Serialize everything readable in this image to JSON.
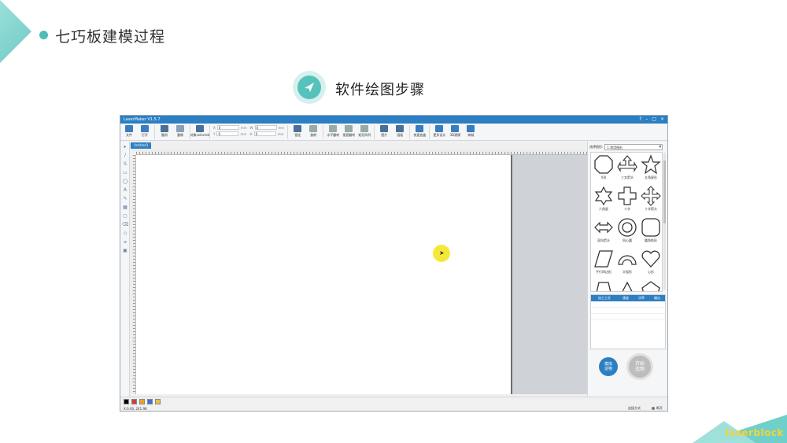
{
  "slide": {
    "title": "七巧板建模过程",
    "step_title": "软件绘图步骤",
    "brand": "laserblock"
  },
  "app": {
    "window_title": "LaserMaker V1.5.7",
    "win_controls": [
      "?",
      "–",
      "□",
      "×"
    ],
    "toolbar": [
      {
        "label": "文件",
        "icon": "folder-icon",
        "color": "#3a7cc0"
      },
      {
        "label": "打开",
        "icon": "file-icon",
        "color": "#3a7cc0"
      },
      {
        "label": "撤消",
        "icon": "undo-icon",
        "color": "#4a6f99"
      },
      {
        "label": "重做",
        "icon": "redo-icon",
        "color": "#8aa0b8"
      },
      {
        "label": "对象selected",
        "icon": "select-icon",
        "color": "#4a6f99"
      }
    ],
    "toolbar_fields": [
      {
        "label": "X",
        "value": "0",
        "unit": "mm"
      },
      {
        "label": "Y",
        "value": "0",
        "unit": "mm"
      },
      {
        "label": "W",
        "value": "0",
        "unit": "mm"
      },
      {
        "label": "H",
        "value": "0",
        "unit": "mm"
      }
    ],
    "toolbar_right": [
      {
        "label": "锁定",
        "icon": "lock-icon",
        "color": "#4a6f99"
      },
      {
        "label": "旋转",
        "icon": "rotate-icon",
        "color": "#9aa"
      },
      {
        "label": "水平翻转",
        "icon": "flip-h-icon",
        "color": "#9aa"
      },
      {
        "label": "垂直翻转",
        "icon": "flip-v-icon",
        "color": "#9aa"
      },
      {
        "label": "矩形阵列",
        "icon": "array-icon",
        "color": "#9aa"
      },
      {
        "label": "图片",
        "icon": "image-icon",
        "color": "#4a6f99"
      },
      {
        "label": "画板",
        "icon": "board-icon",
        "color": "#4a6f99"
      },
      {
        "label": "快速造盒",
        "icon": "box-icon",
        "color": "#3a7cc0"
      },
      {
        "label": "更多设计",
        "icon": "design-icon",
        "color": "#3a7cc0"
      },
      {
        "label": "3D建模",
        "icon": "3d-icon",
        "color": "#3a7cc0"
      },
      {
        "label": "商城",
        "icon": "cart-icon",
        "color": "#3a7cc0"
      }
    ],
    "tab": "Untitled1",
    "left_tools": [
      "▸",
      "/",
      "S",
      "▭",
      "◯",
      "A",
      "✎",
      "▦",
      "▢",
      "⌫",
      "◇",
      "⌀",
      "▣"
    ],
    "right_panel": {
      "select_label": "选择图形:",
      "select_value": "1.常用图形",
      "shapes": [
        {
          "label": "X形",
          "icon": "octagon-shape-icon"
        },
        {
          "label": "三叉箭头",
          "icon": "three-arrow-icon"
        },
        {
          "label": "五角星形",
          "icon": "star5-icon"
        },
        {
          "label": "六角星",
          "icon": "star6-icon"
        },
        {
          "label": "十字",
          "icon": "cross-icon"
        },
        {
          "label": "十字箭头",
          "icon": "cross-arrow-icon"
        },
        {
          "label": "双向箭头",
          "icon": "double-arrow-icon"
        },
        {
          "label": "同心圆",
          "icon": "concentric-icon"
        },
        {
          "label": "圆角矩形",
          "icon": "round-rect-icon"
        },
        {
          "label": "平行四边形",
          "icon": "parallelogram-icon"
        },
        {
          "label": "半弧形",
          "icon": "arc-icon"
        },
        {
          "label": "心形",
          "icon": "heart-icon"
        },
        {
          "label": "",
          "icon": "trapezoid-icon"
        },
        {
          "label": "",
          "icon": "triangle-icon"
        },
        {
          "label": "",
          "icon": "pentagon-icon"
        }
      ],
      "table_headers": [
        "加工工艺",
        "速度",
        "功率",
        "输出"
      ],
      "btn_sim": "模拟\n造物",
      "btn_start": "开始\n造物"
    },
    "status": {
      "colors": [
        "#000000",
        "#d33b3b",
        "#e5a42a",
        "#3b6fd3",
        "#e0c34a"
      ],
      "coord": "X:0.00, 241.98",
      "conn_mode": "连接方式",
      "conn_state": "断开"
    }
  }
}
